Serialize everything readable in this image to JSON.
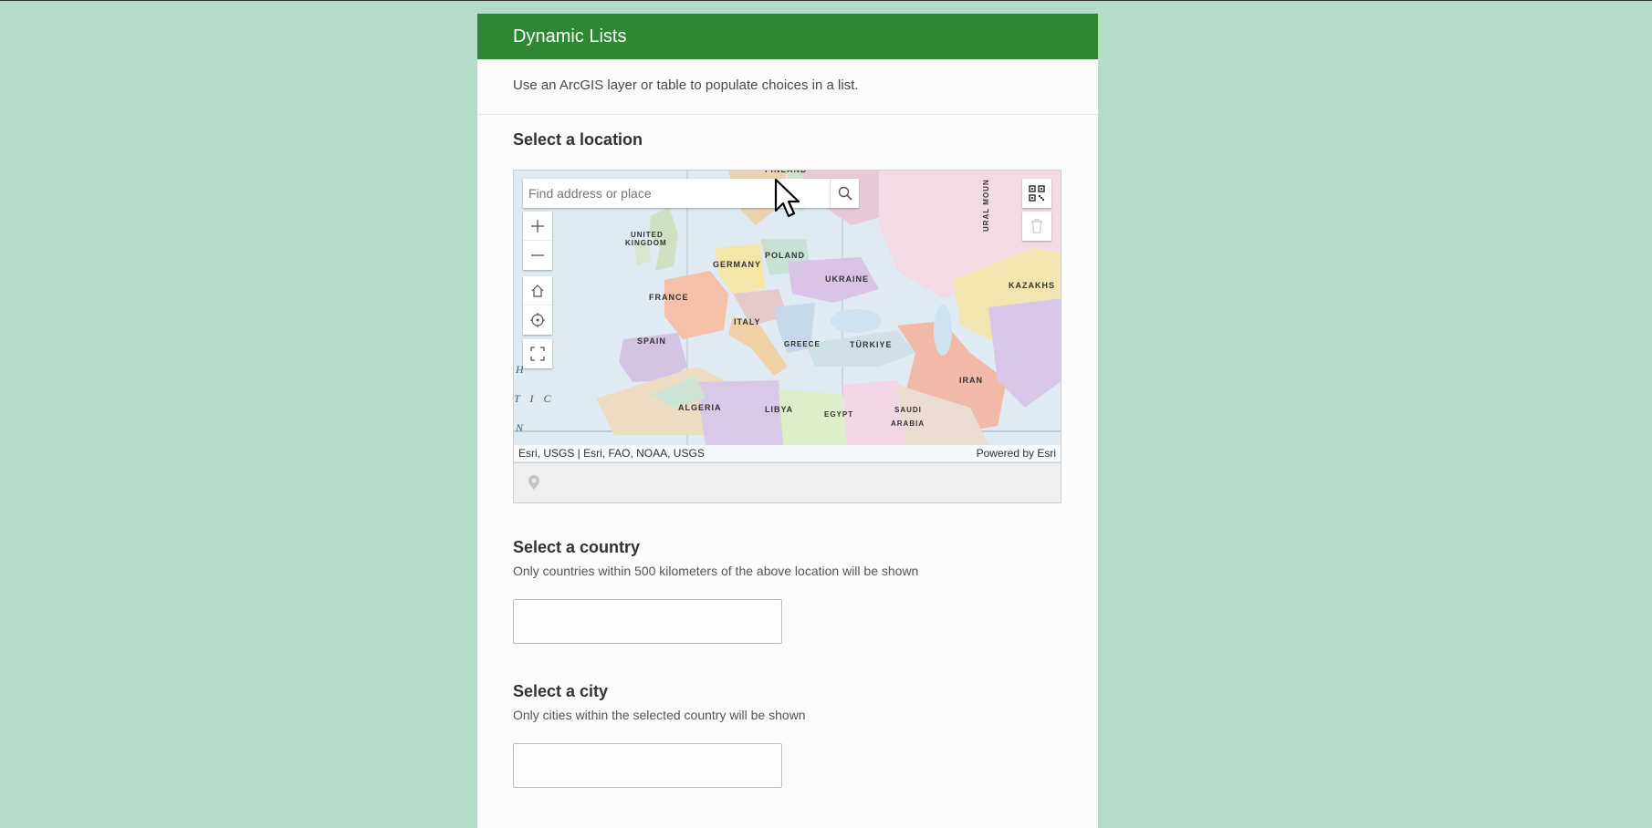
{
  "form": {
    "title": "Dynamic Lists",
    "description": "Use an ArcGIS layer or table to populate choices in a list."
  },
  "questions": {
    "location": {
      "label": "Select a location",
      "map": {
        "search_placeholder": "Find address or place",
        "attribution_left": "Esri, USGS | Esri, FAO, NOAA, USGS",
        "attribution_right": "Powered by Esri",
        "country_labels": [
          "FINLAND",
          "UNITED",
          "KINGDOM",
          "POLAND",
          "GERMANY",
          "UKRAINE",
          "KAZAKHS",
          "FRANCE",
          "ITALY",
          "SPAIN",
          "GREECE",
          "TÜRKIYE",
          "IRAN",
          "ALGERIA",
          "LIBYA",
          "EGYPT",
          "SAUDI",
          "ARABIA",
          "URAL MOUN",
          "H",
          "T I C",
          "N"
        ],
        "icons": {
          "search": "search-icon",
          "zoom_in": "plus-icon",
          "zoom_out": "minus-icon",
          "home": "home-icon",
          "locate": "crosshair-icon",
          "fullscreen": "fullscreen-icon",
          "qr": "qr-code-icon",
          "delete": "trash-icon",
          "location_pin": "map-pin-icon"
        }
      }
    },
    "country": {
      "label": "Select a country",
      "hint": "Only countries within 500 kilometers of the above location will be shown",
      "value": ""
    },
    "city": {
      "label": "Select a city",
      "hint": "Only cities within the selected country will be shown",
      "value": ""
    }
  },
  "colors": {
    "page_background": "#b4dcc8",
    "header": "#2e8732",
    "card": "#fcfcfc"
  }
}
